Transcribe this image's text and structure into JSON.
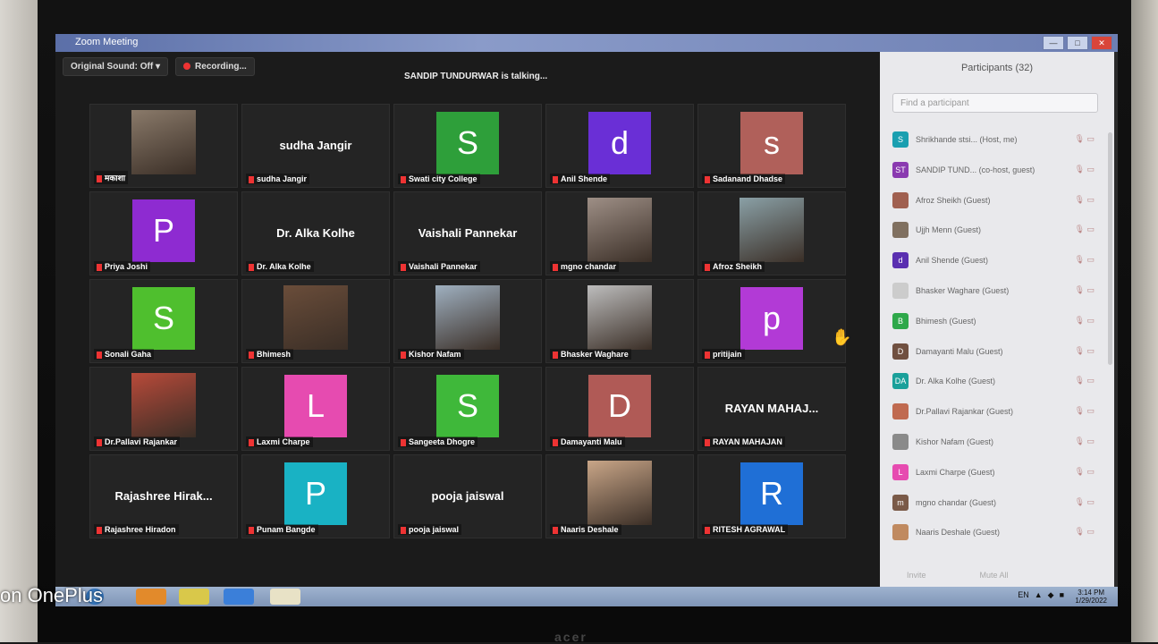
{
  "window": {
    "title": "Zoom Meeting",
    "controls": [
      "—",
      "□",
      "✕"
    ]
  },
  "top": {
    "original_sound": "Original Sound: Off",
    "dropdown": "▾",
    "recording": "Recording..."
  },
  "talking": "SANDIP TUNDURWAR is talking...",
  "tiles": [
    {
      "label": "मकाशा",
      "kind": "photo",
      "color": "#8a7a6a"
    },
    {
      "label": "sudha Jangir",
      "kind": "name",
      "big": "sudha Jangir"
    },
    {
      "label": "Swati city College",
      "kind": "avatar",
      "letter": "S",
      "color": "#2e9f3a"
    },
    {
      "label": "Anil Shende",
      "kind": "avatar",
      "letter": "d",
      "color": "#6a2fd6"
    },
    {
      "label": "Sadanand Dhadse",
      "kind": "avatar",
      "letter": "s",
      "color": "#b0605a"
    },
    {
      "label": "Priya Joshi",
      "kind": "avatar",
      "letter": "P",
      "color": "#8e2bd1"
    },
    {
      "label": "Dr. Alka Kolhe",
      "kind": "name",
      "big": "Dr. Alka Kolhe"
    },
    {
      "label": "Vaishali Pannekar",
      "kind": "name",
      "big": "Vaishali Pannekar"
    },
    {
      "label": "mgno chandar",
      "kind": "photo",
      "color": "#9e8f86"
    },
    {
      "label": "Afroz Sheikh",
      "kind": "photo",
      "color": "#8aa0a6"
    },
    {
      "label": "Sonali Gaha",
      "kind": "avatar",
      "letter": "S",
      "color": "#4fbf2e"
    },
    {
      "label": "Bhimesh",
      "kind": "photo",
      "color": "#6a4d3a"
    },
    {
      "label": "Kishor Nafam",
      "kind": "photo",
      "color": "#9fb0c0"
    },
    {
      "label": "Bhasker Waghare",
      "kind": "photo",
      "color": "#bdbdbd"
    },
    {
      "label": "pritijain",
      "kind": "avatar",
      "letter": "p",
      "color": "#b23ad6"
    },
    {
      "label": "Dr.Pallavi Rajankar",
      "kind": "photo",
      "color": "#b84a3a"
    },
    {
      "label": "Laxmi Charpe",
      "kind": "avatar",
      "letter": "L",
      "color": "#e64bb0"
    },
    {
      "label": "Sangeeta Dhogre",
      "kind": "avatar",
      "letter": "S",
      "color": "#3fb83a"
    },
    {
      "label": "Damayanti Malu",
      "kind": "avatar",
      "letter": "D",
      "color": "#b05a56"
    },
    {
      "label": "RAYAN MAHAJAN",
      "kind": "name",
      "big": "RAYAN MAHAJ..."
    },
    {
      "label": "Rajashree Hiradon",
      "kind": "name",
      "big": "Rajashree Hirak..."
    },
    {
      "label": "Punam Bangde",
      "kind": "avatar",
      "letter": "P",
      "color": "#19b2c4"
    },
    {
      "label": "pooja jaiswal",
      "kind": "name",
      "big": "pooja jaiswal"
    },
    {
      "label": "Naaris Deshale",
      "kind": "photo",
      "color": "#c9a688"
    },
    {
      "label": "RITESH AGRAWAL",
      "kind": "avatar",
      "letter": "R",
      "color": "#1f6fd6"
    }
  ],
  "panel": {
    "title": "Participants (32)",
    "search_placeholder": "Find a participant",
    "participants": [
      {
        "av": "S",
        "color": "#1a9fb0",
        "name": "Shrikhande stsi... (Host, me)"
      },
      {
        "av": "ST",
        "color": "#8a3ab0",
        "name": "SANDIP TUND... (co-host, guest)"
      },
      {
        "av": "",
        "color": "#a06050",
        "name": "Afroz Sheikh (Guest)"
      },
      {
        "av": "",
        "color": "#807060",
        "name": "Ujjh Menn (Guest)"
      },
      {
        "av": "d",
        "color": "#5a2fb0",
        "name": "Anil Shende (Guest)"
      },
      {
        "av": "",
        "color": "#cccccc",
        "name": "Bhasker Waghare (Guest)"
      },
      {
        "av": "B",
        "color": "#2ea84a",
        "name": "Bhimesh (Guest)"
      },
      {
        "av": "D",
        "color": "#705040",
        "name": "Damayanti Malu (Guest)"
      },
      {
        "av": "DA",
        "color": "#1aa09a",
        "name": "Dr. Alka Kolhe (Guest)"
      },
      {
        "av": "",
        "color": "#c06a50",
        "name": "Dr.Pallavi Rajankar (Guest)"
      },
      {
        "av": "",
        "color": "#8a8a8a",
        "name": "Kishor Nafam (Guest)"
      },
      {
        "av": "L",
        "color": "#e64bb0",
        "name": "Laxmi Charpe (Guest)"
      },
      {
        "av": "m",
        "color": "#7a5a48",
        "name": "mgno chandar (Guest)"
      },
      {
        "av": "",
        "color": "#c08a60",
        "name": "Naaris Deshale (Guest)"
      }
    ],
    "footer": [
      "Invite",
      "Mute All"
    ]
  },
  "taskbar": {
    "clock_time": "3:14 PM",
    "clock_date": "1/29/2022",
    "lang": "EN"
  },
  "watermark": "on OnePlus",
  "brand": "acer"
}
